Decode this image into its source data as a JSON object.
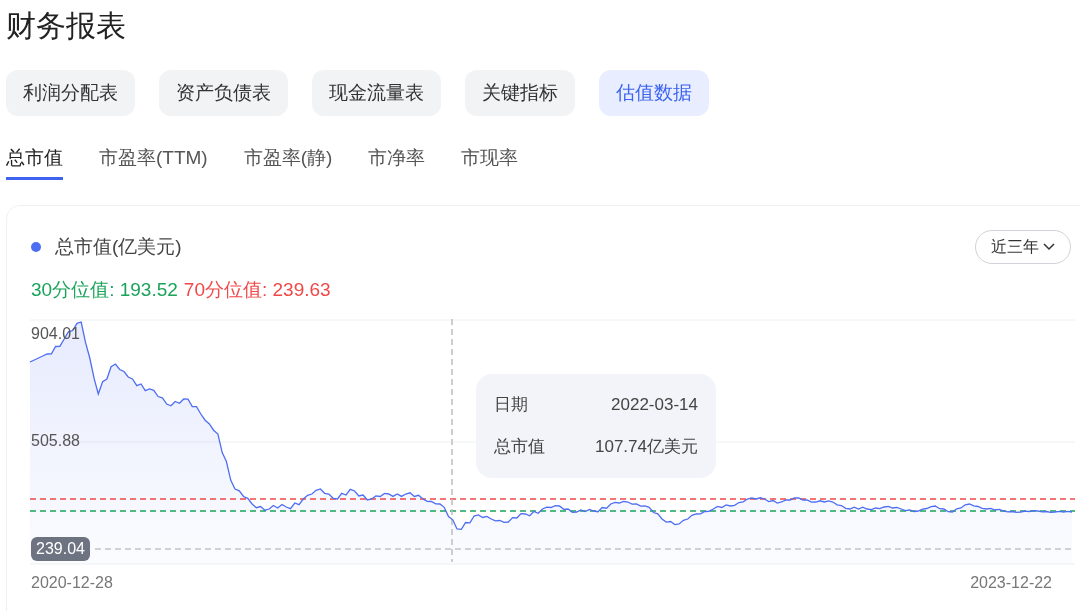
{
  "title": "财务报表",
  "report_tabs": [
    {
      "label": "利润分配表",
      "selected": false
    },
    {
      "label": "资产负债表",
      "selected": false
    },
    {
      "label": "现金流量表",
      "selected": false
    },
    {
      "label": "关键指标",
      "selected": false
    },
    {
      "label": "估值数据",
      "selected": true
    }
  ],
  "metric_tabs": [
    {
      "label": "总市值",
      "selected": true
    },
    {
      "label": "市盈率(TTM)",
      "selected": false
    },
    {
      "label": "市盈率(静)",
      "selected": false
    },
    {
      "label": "市净率",
      "selected": false
    },
    {
      "label": "市现率",
      "selected": false
    }
  ],
  "card": {
    "legend": "总市值(亿美元)",
    "range_dropdown": "近三年",
    "percentiles": [
      {
        "text": "30分位值: 193.52",
        "color": "#1aa35a"
      },
      {
        "text": "70分位值: 239.63",
        "color": "#f04848"
      }
    ],
    "y_axis_labels": [
      "904.01",
      "505.88"
    ],
    "pointer_label": "239.04",
    "x_axis_labels": [
      "2020-12-28",
      "2023-12-22"
    ],
    "tooltip": [
      {
        "label": "日期",
        "value": "2022-03-14"
      },
      {
        "label": "总市值",
        "value": "107.74亿美元"
      }
    ]
  }
}
